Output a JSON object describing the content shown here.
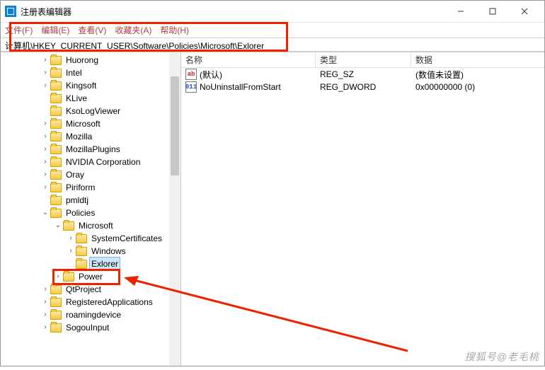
{
  "window": {
    "title": "注册表编辑器"
  },
  "menu": {
    "file": "文件(F)",
    "edit": "编辑(E)",
    "view": "查看(V)",
    "fav": "收藏夹(A)",
    "help": "帮助(H)"
  },
  "address": "计算机\\HKEY_CURRENT_USER\\Software\\Policies\\Microsoft\\Exlorer",
  "tree": {
    "items": [
      {
        "depth": 2,
        "twist": "col",
        "label": "Huorong"
      },
      {
        "depth": 2,
        "twist": "col",
        "label": "Intel"
      },
      {
        "depth": 2,
        "twist": "col",
        "label": "Kingsoft"
      },
      {
        "depth": 2,
        "twist": "",
        "label": "KLive"
      },
      {
        "depth": 2,
        "twist": "",
        "label": "KsoLogViewer"
      },
      {
        "depth": 2,
        "twist": "col",
        "label": "Microsoft"
      },
      {
        "depth": 2,
        "twist": "col",
        "label": "Mozilla"
      },
      {
        "depth": 2,
        "twist": "col",
        "label": "MozillaPlugins"
      },
      {
        "depth": 2,
        "twist": "col",
        "label": "NVIDIA Corporation"
      },
      {
        "depth": 2,
        "twist": "col",
        "label": "Oray"
      },
      {
        "depth": 2,
        "twist": "col",
        "label": "Piriform"
      },
      {
        "depth": 2,
        "twist": "",
        "label": "pmldtj"
      },
      {
        "depth": 2,
        "twist": "exp",
        "label": "Policies"
      },
      {
        "depth": 3,
        "twist": "exp",
        "label": "Microsoft"
      },
      {
        "depth": 4,
        "twist": "col",
        "label": "SystemCertificates"
      },
      {
        "depth": 4,
        "twist": "col",
        "label": "Windows"
      },
      {
        "depth": 4,
        "twist": "",
        "label": "Exlorer",
        "selected": true
      },
      {
        "depth": 3,
        "twist": "col",
        "label": "Power"
      },
      {
        "depth": 2,
        "twist": "col",
        "label": "QtProject"
      },
      {
        "depth": 2,
        "twist": "col",
        "label": "RegisteredApplications"
      },
      {
        "depth": 2,
        "twist": "col",
        "label": "roamingdevice"
      },
      {
        "depth": 2,
        "twist": "col",
        "label": "SogouInput"
      }
    ]
  },
  "values": {
    "headers": {
      "name": "名称",
      "type": "类型",
      "data": "数据"
    },
    "rows": [
      {
        "icon": "str",
        "iconText": "ab",
        "name": "(默认)",
        "type": "REG_SZ",
        "data": "(数值未设置)"
      },
      {
        "icon": "bin",
        "iconText": "011",
        "name": "NoUninstallFromStart",
        "type": "REG_DWORD",
        "data": "0x00000000 (0)"
      }
    ]
  },
  "watermark": "搜狐号@老毛桃"
}
